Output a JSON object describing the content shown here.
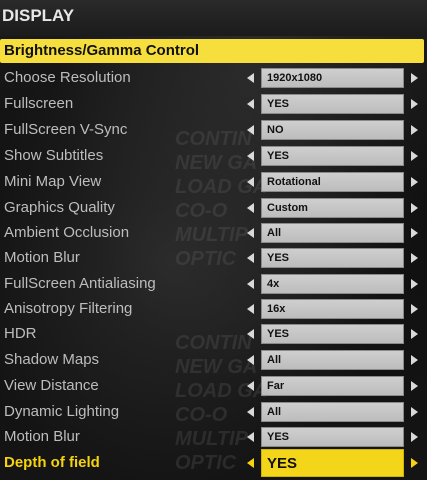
{
  "screen": {
    "title": "DISPLAY",
    "banner_label": "Brightness/Gamma Control",
    "background_menu_text": [
      "CONTIN",
      "NEW GA",
      "LOAD GA",
      "CO-O",
      "MULTIP",
      "OPTIC",
      "CONTIN",
      "NEW GA",
      "LOAD GA",
      "CO-O",
      "MULTIP",
      "OPTIC"
    ],
    "accent_color": "#f6df3d"
  },
  "settings": [
    {
      "label": "Choose Resolution",
      "value": "1920x1080"
    },
    {
      "label": "Fullscreen",
      "value": "YES"
    },
    {
      "label": "FullScreen V-Sync",
      "value": "NO"
    },
    {
      "label": "Show Subtitles",
      "value": "YES"
    },
    {
      "label": "Mini Map View",
      "value": "Rotational"
    },
    {
      "label": "Graphics Quality",
      "value": "Custom"
    },
    {
      "label": "Ambient Occlusion",
      "value": "All"
    },
    {
      "label": "Motion Blur",
      "value": "YES"
    },
    {
      "label": "FullScreen Antialiasing",
      "value": "4x"
    },
    {
      "label": "Anisotropy Filtering",
      "value": "16x"
    },
    {
      "label": "HDR",
      "value": "YES"
    },
    {
      "label": "Shadow Maps",
      "value": "All"
    },
    {
      "label": "View Distance",
      "value": "Far"
    },
    {
      "label": "Dynamic Lighting",
      "value": "All"
    },
    {
      "label": "Motion Blur",
      "value": "YES"
    },
    {
      "label": "Depth of field",
      "value": "YES",
      "active": true
    }
  ],
  "icons": {
    "left": "arrow-left-icon",
    "right": "arrow-right-icon"
  }
}
